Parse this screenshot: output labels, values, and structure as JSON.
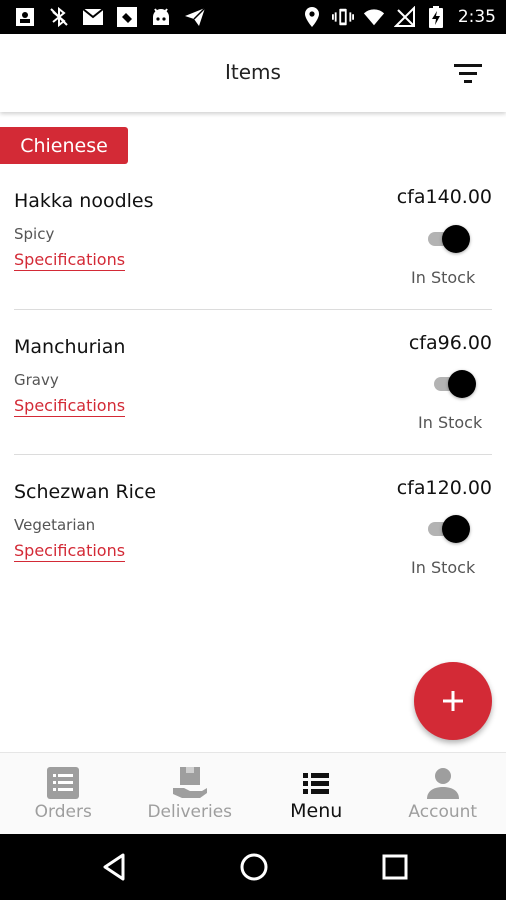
{
  "status_bar": {
    "time": "2:35",
    "left_icons": [
      "contact-card-icon",
      "bluetooth-off-icon",
      "mail-icon",
      "app-icon",
      "android-icon",
      "send-icon"
    ],
    "right_icons": [
      "location-icon",
      "vibrate-icon",
      "wifi-icon",
      "no-signal-icon",
      "battery-charging-icon"
    ]
  },
  "header": {
    "title": "Items",
    "filter_icon": "filter-icon"
  },
  "category": {
    "label": "Chienese"
  },
  "items": [
    {
      "name": "Hakka noodles",
      "description": "Spicy",
      "spec_label": "Specifications",
      "price": "cfa140.00",
      "in_stock": true,
      "stock_label": "In Stock"
    },
    {
      "name": "Manchurian",
      "description": "Gravy",
      "spec_label": "Specifications",
      "price": "cfa96.00",
      "in_stock": true,
      "stock_label": "In Stock"
    },
    {
      "name": "Schezwan Rice",
      "description": "Vegetarian",
      "spec_label": "Specifications",
      "price": "cfa120.00",
      "in_stock": true,
      "stock_label": "In Stock"
    }
  ],
  "fab": {
    "icon": "plus-icon"
  },
  "bottom_nav": {
    "active": "Menu",
    "items": [
      {
        "label": "Orders",
        "icon": "orders-list-icon"
      },
      {
        "label": "Deliveries",
        "icon": "delivery-box-icon"
      },
      {
        "label": "Menu",
        "icon": "menu-list-icon"
      },
      {
        "label": "Account",
        "icon": "person-icon"
      }
    ]
  },
  "colors": {
    "accent": "#d32a36",
    "text_primary": "#111111",
    "text_secondary": "#555555",
    "nav_inactive": "#9e9e9e"
  }
}
